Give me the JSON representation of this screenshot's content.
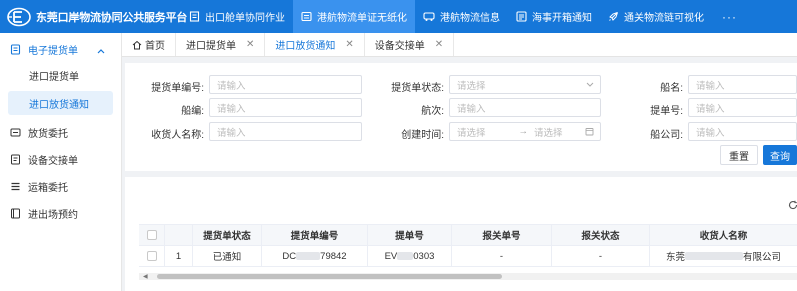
{
  "app": {
    "title": "东莞口岸物流协同公共服务平台",
    "nav": [
      {
        "label": "出口舱单协同作业",
        "icon": "ship-manifest-icon",
        "active": false
      },
      {
        "label": "港航物流单证无纸化",
        "icon": "document-icon",
        "active": true
      },
      {
        "label": "港航物流信息",
        "icon": "truck-icon",
        "active": false
      },
      {
        "label": "海事开箱通知",
        "icon": "notice-icon",
        "active": false
      },
      {
        "label": "通关物流链可视化",
        "icon": "rocket-icon",
        "active": false
      }
    ],
    "nav_more": "···"
  },
  "sidebar": {
    "group": "电子提货单",
    "sub_items": [
      {
        "label": "进口提货单",
        "active": false
      },
      {
        "label": "进口放货通知",
        "active": true
      }
    ],
    "items": [
      {
        "label": "放货委托"
      },
      {
        "label": "设备交接单"
      },
      {
        "label": "运箱委托"
      },
      {
        "label": "进出场预约"
      }
    ]
  },
  "tabs": {
    "home": "首页",
    "items": [
      {
        "label": "进口提货单",
        "active": false
      },
      {
        "label": "进口放货通知",
        "active": true
      },
      {
        "label": "设备交接单",
        "active": false
      }
    ]
  },
  "filters": {
    "bill_no_label": "提货单编号:",
    "bill_no_placeholder": "请输入",
    "bill_status_label": "提货单状态:",
    "bill_status_placeholder": "请选择",
    "vessel_name_label": "船名:",
    "vessel_name_placeholder": "请输入",
    "vessel_code_label": "船编:",
    "vessel_code_placeholder": "请输入",
    "voyage_label": "航次:",
    "voyage_placeholder": "请输入",
    "bl_no_label": "提单号:",
    "bl_no_placeholder": "请输入",
    "consignee_label": "收货人名称:",
    "consignee_placeholder": "请输入",
    "created_label": "创建时间:",
    "created_start_placeholder": "请选择",
    "created_arrow": "→",
    "created_end_placeholder": "请选择",
    "carrier_label": "船公司:",
    "carrier_placeholder": "请输入",
    "reset_label": "重置",
    "query_label": "查询"
  },
  "table": {
    "columns": [
      "",
      "",
      "提货单状态",
      "提货单编号",
      "提单号",
      "报关单号",
      "报关状态",
      "收货人名称"
    ],
    "rows": [
      {
        "index": "1",
        "status": "已通知",
        "bill_no_prefix": "DC",
        "bill_no_suffix": "79842",
        "bl_no_prefix": "EV",
        "bl_no_suffix": "0303",
        "customs_no": "-",
        "customs_status": "-",
        "consignee_prefix": "东莞",
        "consignee_suffix": "有限公司"
      }
    ]
  }
}
